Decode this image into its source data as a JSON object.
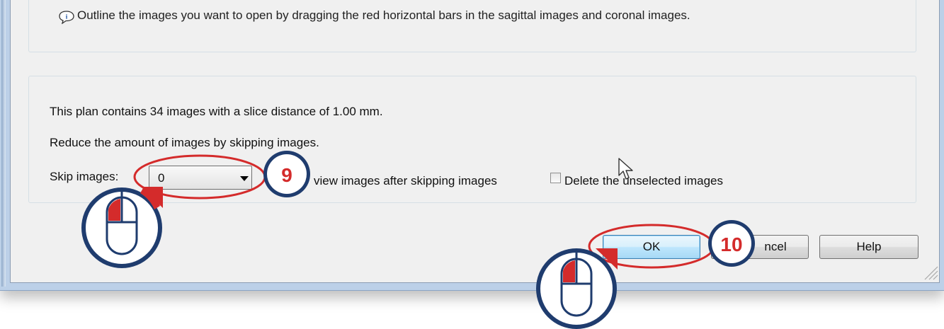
{
  "info": {
    "icon": "info-speech-bubble-icon",
    "text": "Outline the images you want to open by dragging the red horizontal bars in the sagittal images and coronal images."
  },
  "plan": {
    "summary": "This plan contains 34 images with a slice distance of 1.00 mm.",
    "reduce_text": "Reduce the amount of images by skipping images.",
    "skip_label": "Skip images:",
    "skip_value": "0",
    "preview_label": "view images after skipping images",
    "delete_checked": false,
    "delete_label": "Delete the unselected images"
  },
  "buttons": {
    "ok": "OK",
    "cancel": "ncel",
    "help": "Help"
  },
  "annotations": {
    "step9": "9",
    "step10": "10",
    "mouse_icon": "mouse-left-click-icon",
    "highlight_color": "#d42b2b",
    "badge_border_color": "#1f3c6e"
  }
}
